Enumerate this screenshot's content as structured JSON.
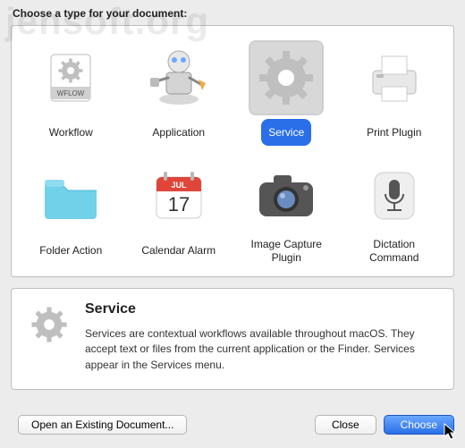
{
  "watermark": "jensoft.org",
  "heading": "Choose a type for your document:",
  "types": [
    {
      "label": "Workflow",
      "icon": "workflow-icon"
    },
    {
      "label": "Application",
      "icon": "application-icon"
    },
    {
      "label": "Service",
      "icon": "service-icon",
      "selected": true
    },
    {
      "label": "Print Plugin",
      "icon": "print-plugin-icon"
    },
    {
      "label": "Folder Action",
      "icon": "folder-action-icon"
    },
    {
      "label": "Calendar Alarm",
      "icon": "calendar-alarm-icon"
    },
    {
      "label": "Image Capture Plugin",
      "icon": "image-capture-icon"
    },
    {
      "label": "Dictation Command",
      "icon": "dictation-command-icon"
    }
  ],
  "detail": {
    "title": "Service",
    "description": "Services are contextual workflows available throughout macOS. They accept text or files from the current application or the Finder. Services appear in the Services menu."
  },
  "buttons": {
    "open_existing": "Open an Existing Document...",
    "close": "Close",
    "choose": "Choose"
  },
  "calendar_badge": {
    "month": "JUL",
    "day": "17"
  }
}
